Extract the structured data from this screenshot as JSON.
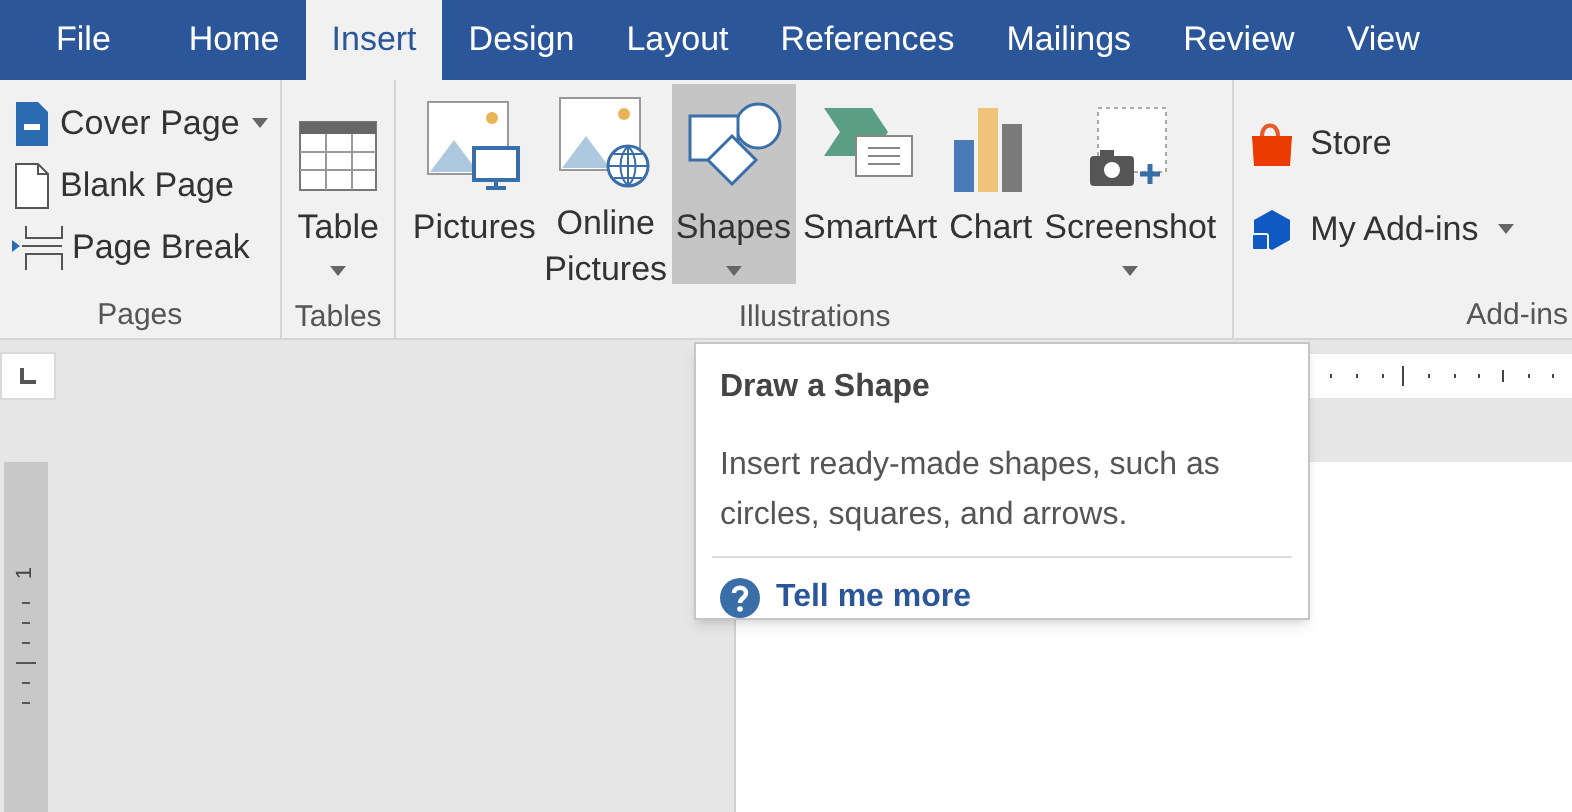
{
  "tabs": [
    {
      "label": "File",
      "selected": false
    },
    {
      "label": "Home",
      "selected": false
    },
    {
      "label": "Insert",
      "selected": true
    },
    {
      "label": "Design",
      "selected": false
    },
    {
      "label": "Layout",
      "selected": false
    },
    {
      "label": "References",
      "selected": false
    },
    {
      "label": "Mailings",
      "selected": false
    },
    {
      "label": "Review",
      "selected": false
    },
    {
      "label": "View",
      "selected": false
    }
  ],
  "ribbon": {
    "groups": [
      {
        "label": "Pages",
        "commands": [
          {
            "label": "Cover Page",
            "menu": true
          },
          {
            "label": "Blank Page",
            "menu": false
          },
          {
            "label": "Page Break",
            "menu": false
          }
        ]
      },
      {
        "label": "Tables",
        "commands": [
          {
            "label": "Table",
            "menu": true,
            "selected": false
          }
        ]
      },
      {
        "label": "Illustrations",
        "commands": [
          {
            "label": "Pictures",
            "menu": false,
            "selected": false
          },
          {
            "label": "Online Pictures",
            "menu": false,
            "selected": false
          },
          {
            "label": "Shapes",
            "menu": true,
            "selected": true
          },
          {
            "label": "SmartArt",
            "menu": false,
            "selected": false
          },
          {
            "label": "Chart",
            "menu": false,
            "selected": false
          },
          {
            "label": "Screenshot",
            "menu": true,
            "selected": false
          }
        ]
      },
      {
        "label": "Add-ins",
        "commands": [
          {
            "label": "Store",
            "menu": false
          },
          {
            "label": "My Add-ins",
            "menu": true
          }
        ]
      }
    ]
  },
  "vertical_ruler": {
    "label": "1"
  },
  "tooltip": {
    "title": "Draw a Shape",
    "description": "Insert ready-made shapes, such as circles, squares, and arrows.",
    "link": "Tell me more"
  }
}
